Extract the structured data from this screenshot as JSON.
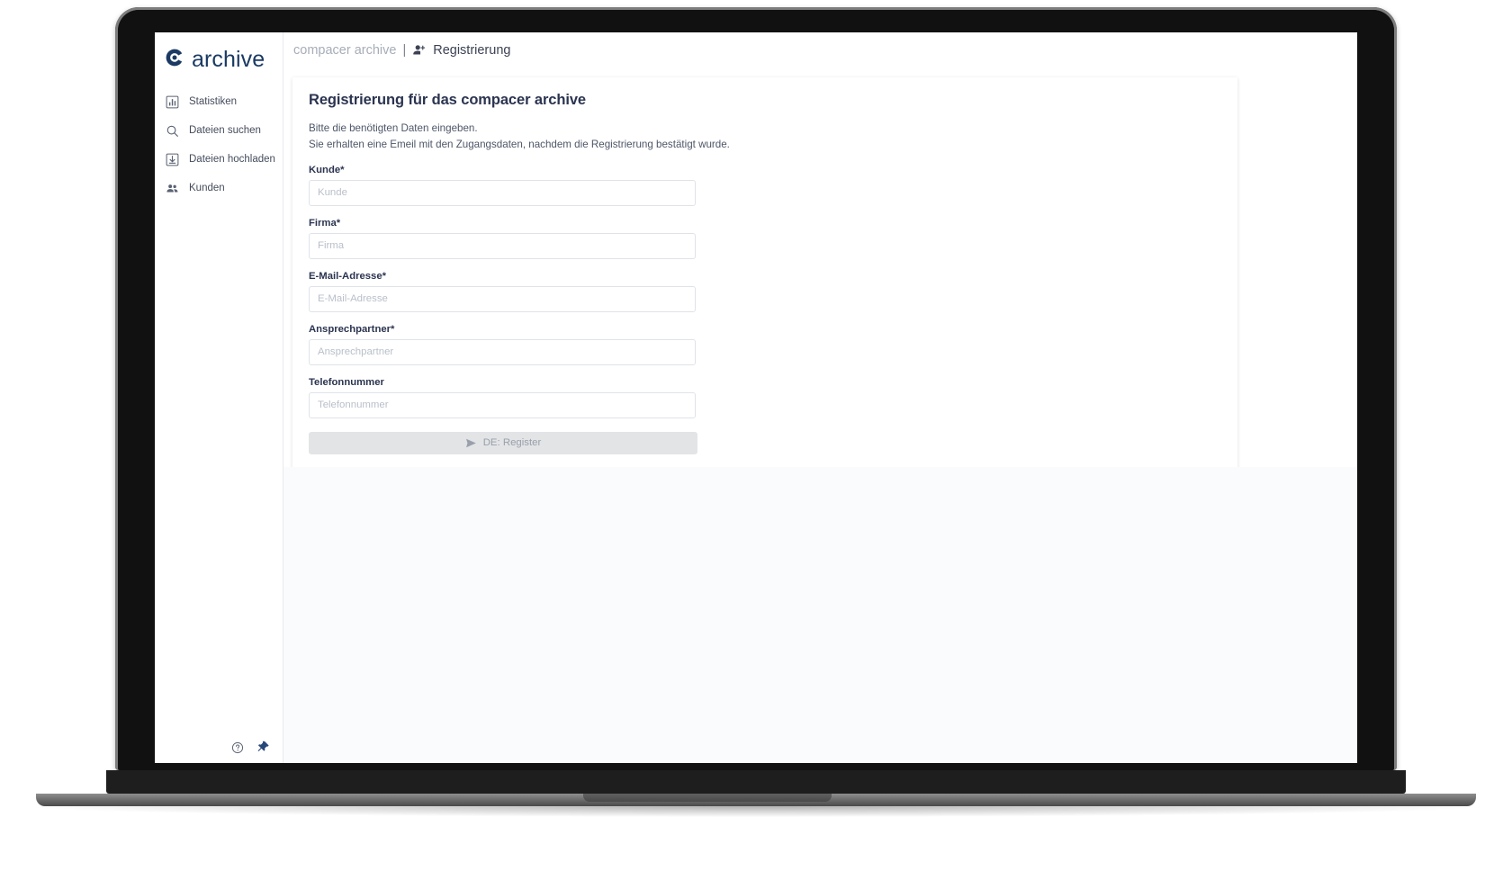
{
  "brand": {
    "name": "archive",
    "logo_icon": "compacer-c-logo-icon",
    "logo_color": "#1b3a63"
  },
  "sidebar": {
    "items": [
      {
        "label": "Statistiken",
        "icon": "bar-chart-icon"
      },
      {
        "label": "Dateien suchen",
        "icon": "search-icon"
      },
      {
        "label": "Dateien hochladen",
        "icon": "download-box-icon"
      },
      {
        "label": "Kunden",
        "icon": "users-icon"
      }
    ],
    "footer": {
      "help_icon": "help-circle-icon",
      "pin_icon": "pin-icon"
    }
  },
  "topbar": {
    "app_name": "compacer archive",
    "separator": "|",
    "page_icon": "person-add-icon",
    "page_title": "Registrierung"
  },
  "card": {
    "title": "Registrierung für das compacer archive",
    "intro_line_1": "Bitte die benötigten Daten eingeben.",
    "intro_line_2": "Sie erhalten eine Emeil mit den Zugangsdaten, nachdem die Registrierung bestätigt wurde.",
    "fields": [
      {
        "label": "Kunde*",
        "placeholder": "Kunde",
        "value": ""
      },
      {
        "label": "Firma*",
        "placeholder": "Firma",
        "value": ""
      },
      {
        "label": "E-Mail-Adresse*",
        "placeholder": "E-Mail-Adresse",
        "value": ""
      },
      {
        "label": "Ansprechpartner*",
        "placeholder": "Ansprechpartner",
        "value": ""
      },
      {
        "label": "Telefonnummer",
        "placeholder": "Telefonnummer",
        "value": ""
      }
    ],
    "submit": {
      "label": "DE: Register",
      "icon": "send-icon"
    }
  },
  "colors": {
    "brand_navy": "#1b3a63",
    "heading": "#2b3450",
    "muted_text": "#a7adb8",
    "placeholder": "#b9bfc9",
    "button_bg": "#e2e4e6",
    "page_bg": "#f2f4f6"
  }
}
